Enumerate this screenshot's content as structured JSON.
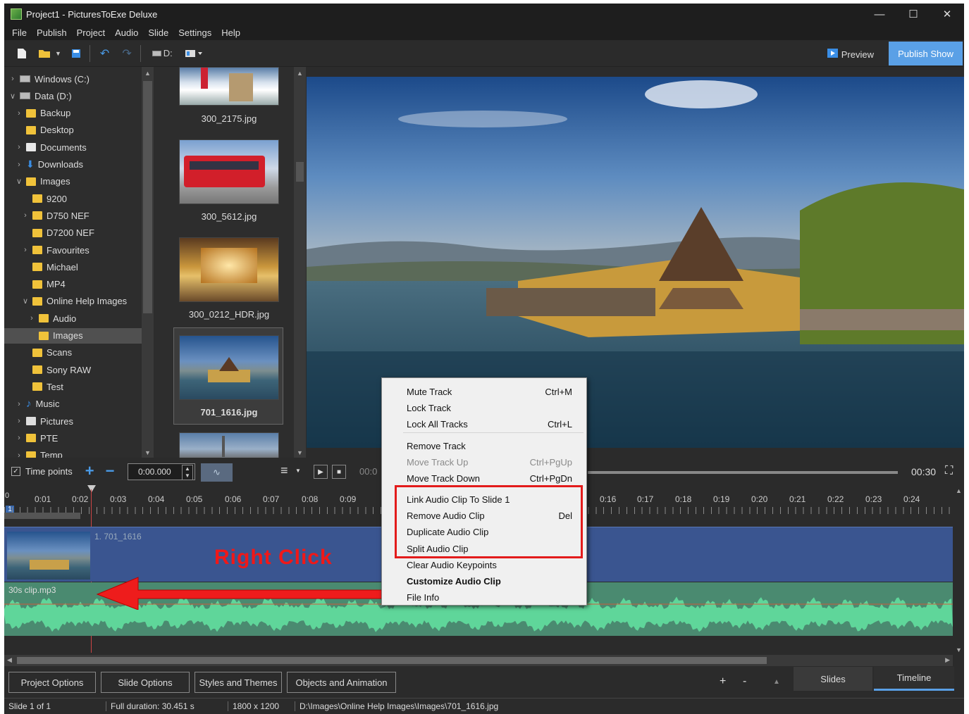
{
  "window": {
    "title": "Project1 - PicturesToExe Deluxe"
  },
  "menu": [
    "File",
    "Publish",
    "Project",
    "Audio",
    "Slide",
    "Settings",
    "Help"
  ],
  "toolbar": {
    "drive_label": "D:",
    "preview_label": "Preview",
    "publish_label": "Publish Show"
  },
  "tree": [
    {
      "label": "Windows (C:)",
      "level": 0,
      "arrow": ">",
      "icon": "drive"
    },
    {
      "label": "Data (D:)",
      "level": 0,
      "arrow": "v",
      "icon": "drive"
    },
    {
      "label": "Backup",
      "level": 1,
      "arrow": ">",
      "icon": "folder"
    },
    {
      "label": "Desktop",
      "level": 1,
      "arrow": "",
      "icon": "folder"
    },
    {
      "label": "Documents",
      "level": 1,
      "arrow": ">",
      "icon": "documents"
    },
    {
      "label": "Downloads",
      "level": 1,
      "arrow": ">",
      "icon": "download"
    },
    {
      "label": "Images",
      "level": 1,
      "arrow": "v",
      "icon": "folder"
    },
    {
      "label": "9200",
      "level": 2,
      "arrow": "",
      "icon": "folder"
    },
    {
      "label": "D750 NEF",
      "level": 2,
      "arrow": ">",
      "icon": "folder"
    },
    {
      "label": "D7200 NEF",
      "level": 2,
      "arrow": "",
      "icon": "folder"
    },
    {
      "label": "Favourites",
      "level": 2,
      "arrow": ">",
      "icon": "folder"
    },
    {
      "label": "Michael",
      "level": 2,
      "arrow": "",
      "icon": "folder"
    },
    {
      "label": "MP4",
      "level": 2,
      "arrow": "",
      "icon": "folder"
    },
    {
      "label": "Online Help Images",
      "level": 2,
      "arrow": "v",
      "icon": "folder"
    },
    {
      "label": "Audio",
      "level": 3,
      "arrow": ">",
      "icon": "folder"
    },
    {
      "label": "Images",
      "level": 3,
      "arrow": "",
      "icon": "folder",
      "selected": true
    },
    {
      "label": "Scans",
      "level": 2,
      "arrow": "",
      "icon": "folder"
    },
    {
      "label": "Sony RAW",
      "level": 2,
      "arrow": "",
      "icon": "folder"
    },
    {
      "label": "Test",
      "level": 2,
      "arrow": "",
      "icon": "folder"
    },
    {
      "label": "Music",
      "level": 1,
      "arrow": ">",
      "icon": "music"
    },
    {
      "label": "Pictures",
      "level": 1,
      "arrow": ">",
      "icon": "pictures"
    },
    {
      "label": "PTE",
      "level": 1,
      "arrow": ">",
      "icon": "folder"
    },
    {
      "label": "Temp",
      "level": 1,
      "arrow": ">",
      "icon": "folder"
    }
  ],
  "thumbs": [
    {
      "label": "300_2175.jpg"
    },
    {
      "label": "300_5612.jpg"
    },
    {
      "label": "300_0212_HDR.jpg"
    },
    {
      "label": "701_1616.jpg",
      "selected": true
    }
  ],
  "timeline": {
    "timepoints_label": "Time points",
    "time_value": "0:00.000",
    "current_time_partial": "00:0",
    "total_time": "00:30",
    "start_mark": "0",
    "slide_marker": "1",
    "ticks": [
      "0:01",
      "0:02",
      "0:03",
      "0:04",
      "0:05",
      "0:06",
      "0:07",
      "0:08",
      "0:09",
      "0:16",
      "0:17",
      "0:18",
      "0:19",
      "0:20",
      "0:21",
      "0:22",
      "0:23",
      "0:24"
    ],
    "slide_clip_label": "1. 701_1616",
    "audio_clip_label": "30s clip.mp3"
  },
  "context_menu": {
    "items": [
      {
        "label": "Mute Track",
        "shortcut": "Ctrl+M"
      },
      {
        "label": "Lock Track",
        "shortcut": ""
      },
      {
        "label": "Lock All Tracks",
        "shortcut": "Ctrl+L"
      },
      {
        "label": "Remove Track",
        "shortcut": ""
      },
      {
        "label": "Move Track Up",
        "shortcut": "Ctrl+PgUp",
        "disabled": true
      },
      {
        "label": "Move Track Down",
        "shortcut": "Ctrl+PgDn"
      },
      {
        "label": "Link Audio Clip To Slide 1",
        "shortcut": ""
      },
      {
        "label": "Remove Audio Clip",
        "shortcut": "Del"
      },
      {
        "label": "Duplicate Audio Clip",
        "shortcut": ""
      },
      {
        "label": "Split Audio Clip",
        "shortcut": ""
      },
      {
        "label": "Clear Audio Keypoints",
        "shortcut": ""
      },
      {
        "label": "Customize Audio Clip",
        "shortcut": "",
        "bold": true
      },
      {
        "label": "File Info",
        "shortcut": ""
      }
    ]
  },
  "annotation": {
    "text": "Right Click",
    "color": "#f01818"
  },
  "bottom_buttons": [
    "Project Options",
    "Slide Options",
    "Styles and Themes",
    "Objects and Animation"
  ],
  "bottom_tabs": {
    "slides": "Slides",
    "timeline": "Timeline",
    "plus": "+",
    "minus": "-"
  },
  "status": {
    "slide": "Slide 1 of 1",
    "duration": "Full duration: 30.451 s",
    "resolution": "1800 x 1200",
    "path": "D:\\Images\\Online Help Images\\Images\\701_1616.jpg"
  },
  "colors": {
    "accent": "#5aa0e6",
    "highlight": "#e31b1b",
    "slide_track": "#3a5590",
    "audio_track": "#4a8a70",
    "waveform": "#5fd69a"
  }
}
